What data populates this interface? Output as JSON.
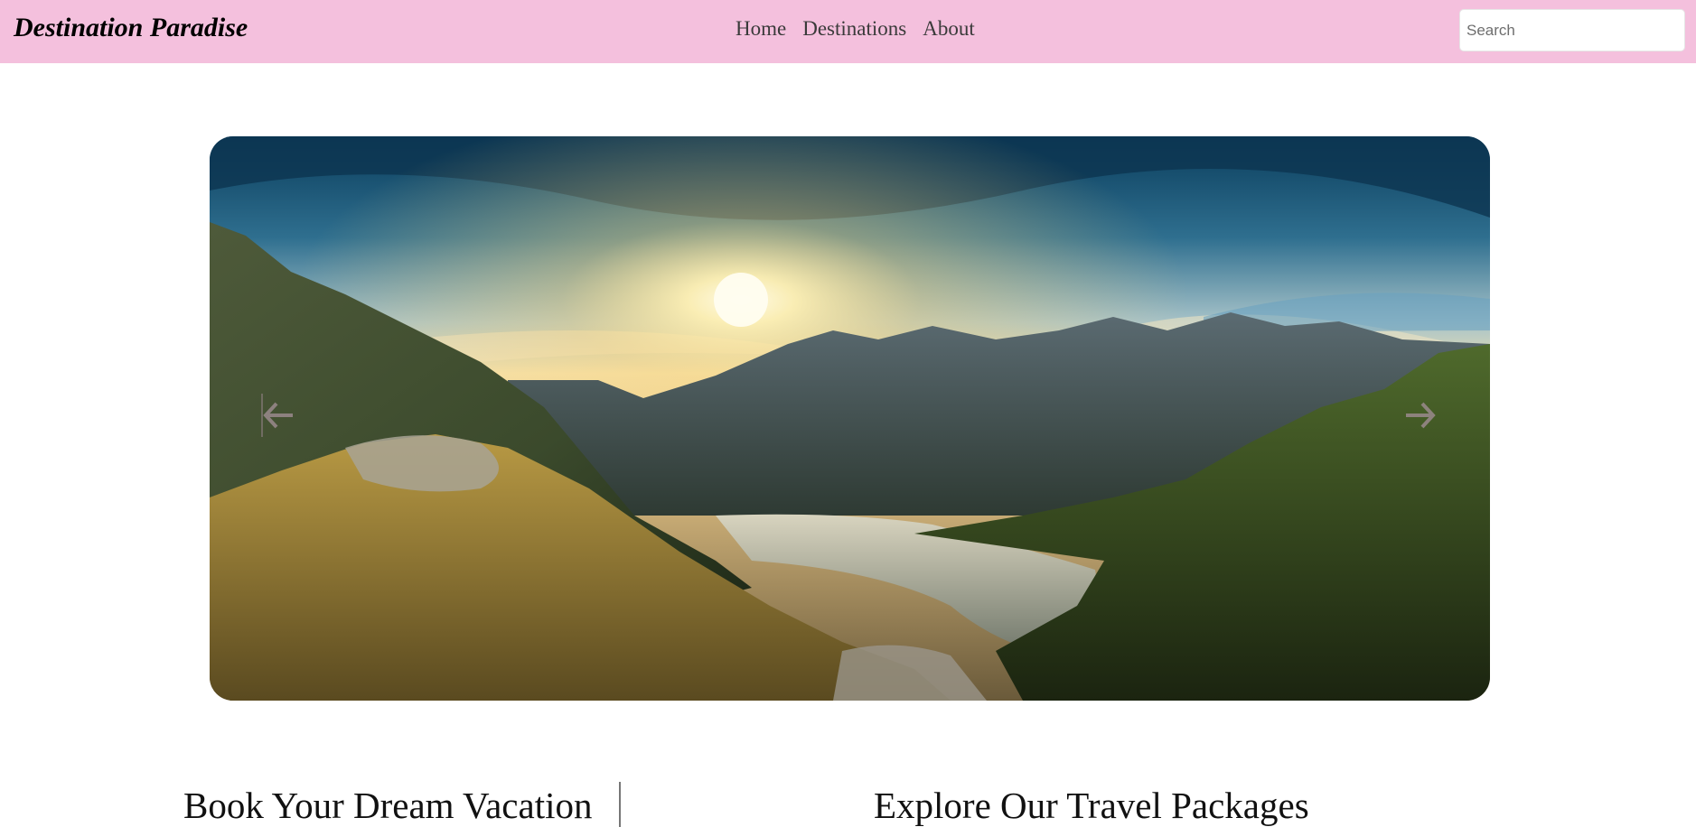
{
  "header": {
    "brand": "Destination Paradise",
    "nav": [
      "Home",
      "Destinations",
      "About"
    ],
    "search_placeholder": "Search",
    "background_color": "#f4c0dd"
  },
  "carousel": {
    "image_description_icon": "landscape-photo",
    "prev_icon": "arrow-left-icon",
    "next_icon": "arrow-right-icon"
  },
  "sections": {
    "left_heading": "Book Your Dream Vacation",
    "right_heading": "Explore Our Travel Packages"
  }
}
